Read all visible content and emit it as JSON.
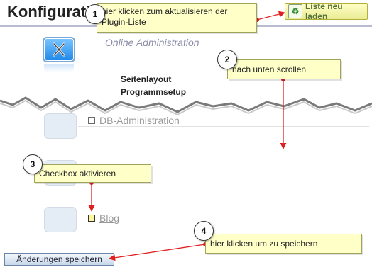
{
  "page": {
    "title": "Konfiguration",
    "reload_button": "Liste neu laden",
    "save_button": "Änderungen speichern"
  },
  "sections": {
    "online_admin": "Online Administration",
    "seitenlayout": "Seitenlayout",
    "programmsetup": "Programmsetup"
  },
  "plugins": [
    {
      "label": "DB-Administration",
      "checked": false
    },
    {
      "label": "Blog",
      "checked": true
    }
  ],
  "annotations": [
    {
      "number": "1",
      "text": "hier klicken zum aktualisieren der Plugin-Liste"
    },
    {
      "number": "2",
      "text": "nach unten scrollen"
    },
    {
      "number": "3",
      "text": "Checkbox aktivieren"
    },
    {
      "number": "4",
      "text": "hier klicken um zu speichern"
    }
  ],
  "colors": {
    "callout_bg": "#ffffc8",
    "arrow": "#e02020",
    "accent_blue": "#1d88ea"
  },
  "icons": [
    "tools-icon",
    "recycle-icon"
  ]
}
